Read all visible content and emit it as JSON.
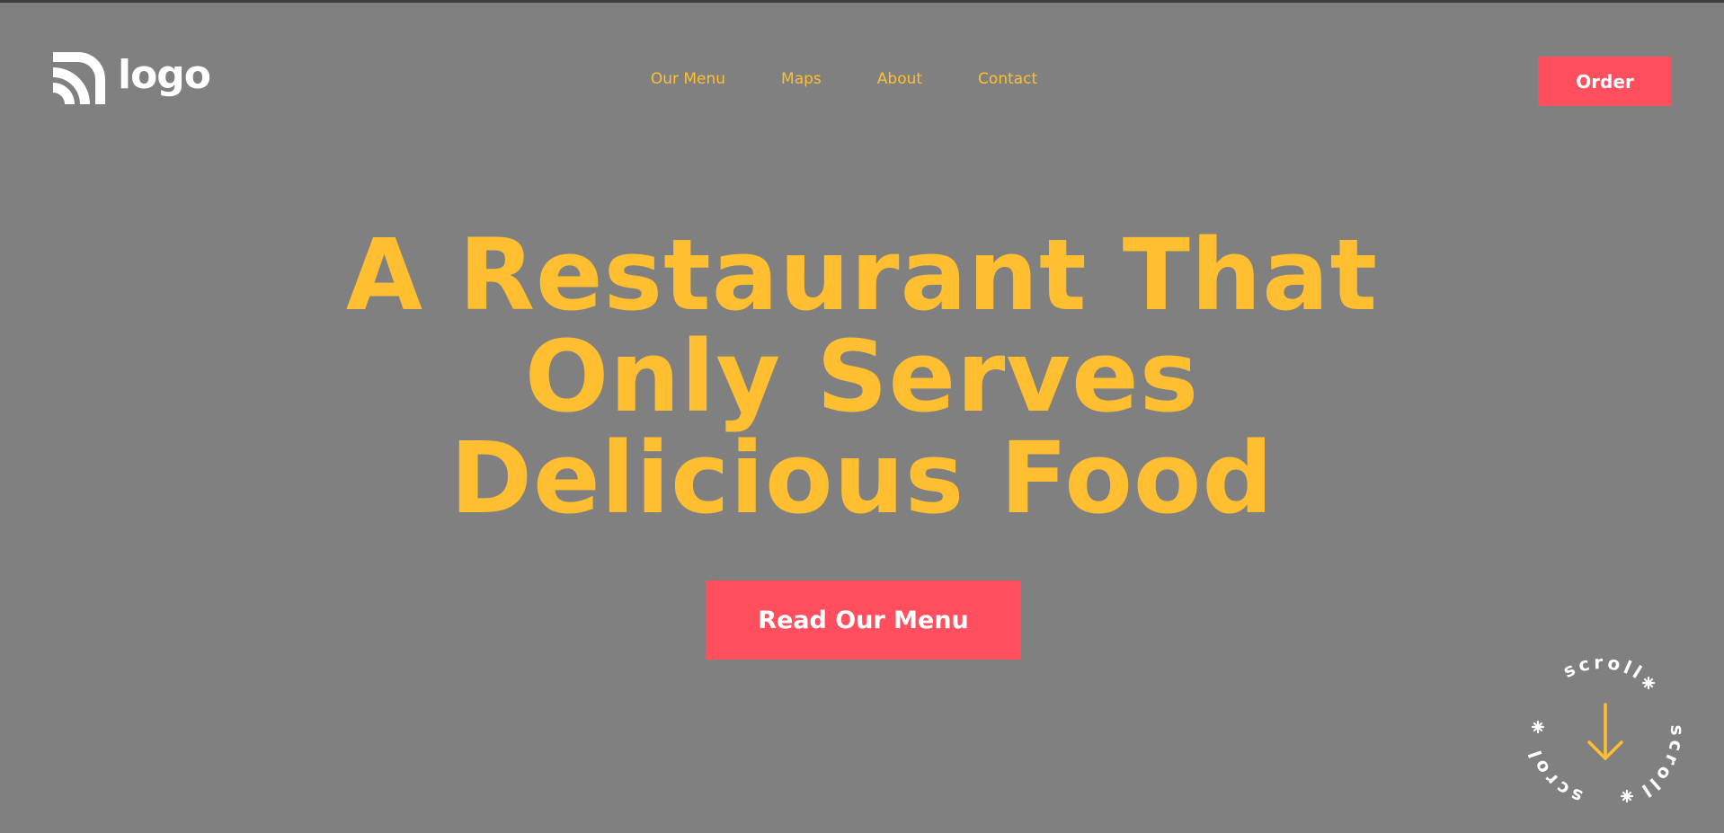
{
  "header": {
    "logo_text": "logo",
    "nav": [
      {
        "label": "Our Menu"
      },
      {
        "label": "Maps"
      },
      {
        "label": "About"
      },
      {
        "label": "Contact"
      }
    ],
    "order_label": "Order"
  },
  "hero": {
    "title_lines": [
      "A Restaurant That",
      "Only Serves",
      "Delicious Food"
    ],
    "cta_label": "Read Our Menu"
  },
  "scroll_badge": {
    "text": "scroll",
    "icon": "arrow-down-icon"
  },
  "colors": {
    "background": "#808080",
    "accent_yellow": "#ffbf30",
    "button_red": "#ff4e5e",
    "white": "#ffffff"
  }
}
